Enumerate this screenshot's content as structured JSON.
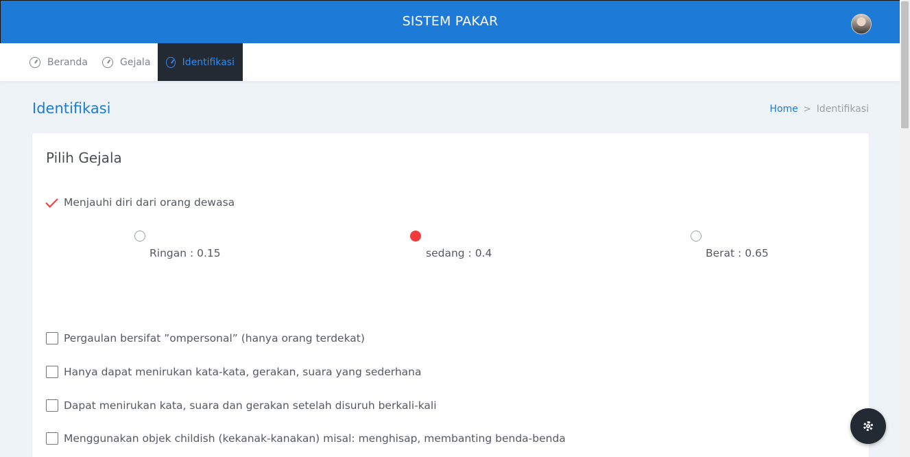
{
  "app": {
    "title": "SISTEM PAKAR"
  },
  "nav": {
    "items": [
      {
        "label": "Beranda",
        "icon": "dashboard-icon",
        "active": false
      },
      {
        "label": "Gejala",
        "icon": "dashboard-icon",
        "active": false
      },
      {
        "label": "Identifikasi",
        "icon": "dashboard-icon",
        "active": true
      }
    ]
  },
  "page": {
    "title": "Identifikasi",
    "breadcrumb": {
      "home": "Home",
      "separator": ">",
      "current": "Identifikasi"
    }
  },
  "card": {
    "title": "Pilih Gejala",
    "selected_symptom": {
      "label": "Menjauhi diri dari orang dewasa",
      "checked": true,
      "options": [
        {
          "label": "Ringan : 0.15",
          "selected": false
        },
        {
          "label": "sedang : 0.4",
          "selected": true
        },
        {
          "label": "Berat : 0.65",
          "selected": false
        }
      ]
    },
    "symptoms": [
      {
        "label": "Pergaulan bersifat ”ompersonal” (hanya orang terdekat)",
        "checked": false
      },
      {
        "label": "Hanya dapat menirukan kata-kata, gerakan, suara yang sederhana",
        "checked": false
      },
      {
        "label": "Dapat menirukan kata, suara dan gerakan setelah disuruh berkali-kali",
        "checked": false
      },
      {
        "label": "Menggunakan objek childish (kekanak-kanakan) misal: menghisap, membanting benda-benda",
        "checked": false
      }
    ]
  },
  "colors": {
    "primary": "#1d7ad6",
    "dark": "#232a33",
    "accent_red": "#ef3b3b",
    "background": "#eef3f8"
  },
  "fab": {
    "icon": "gear-icon"
  }
}
